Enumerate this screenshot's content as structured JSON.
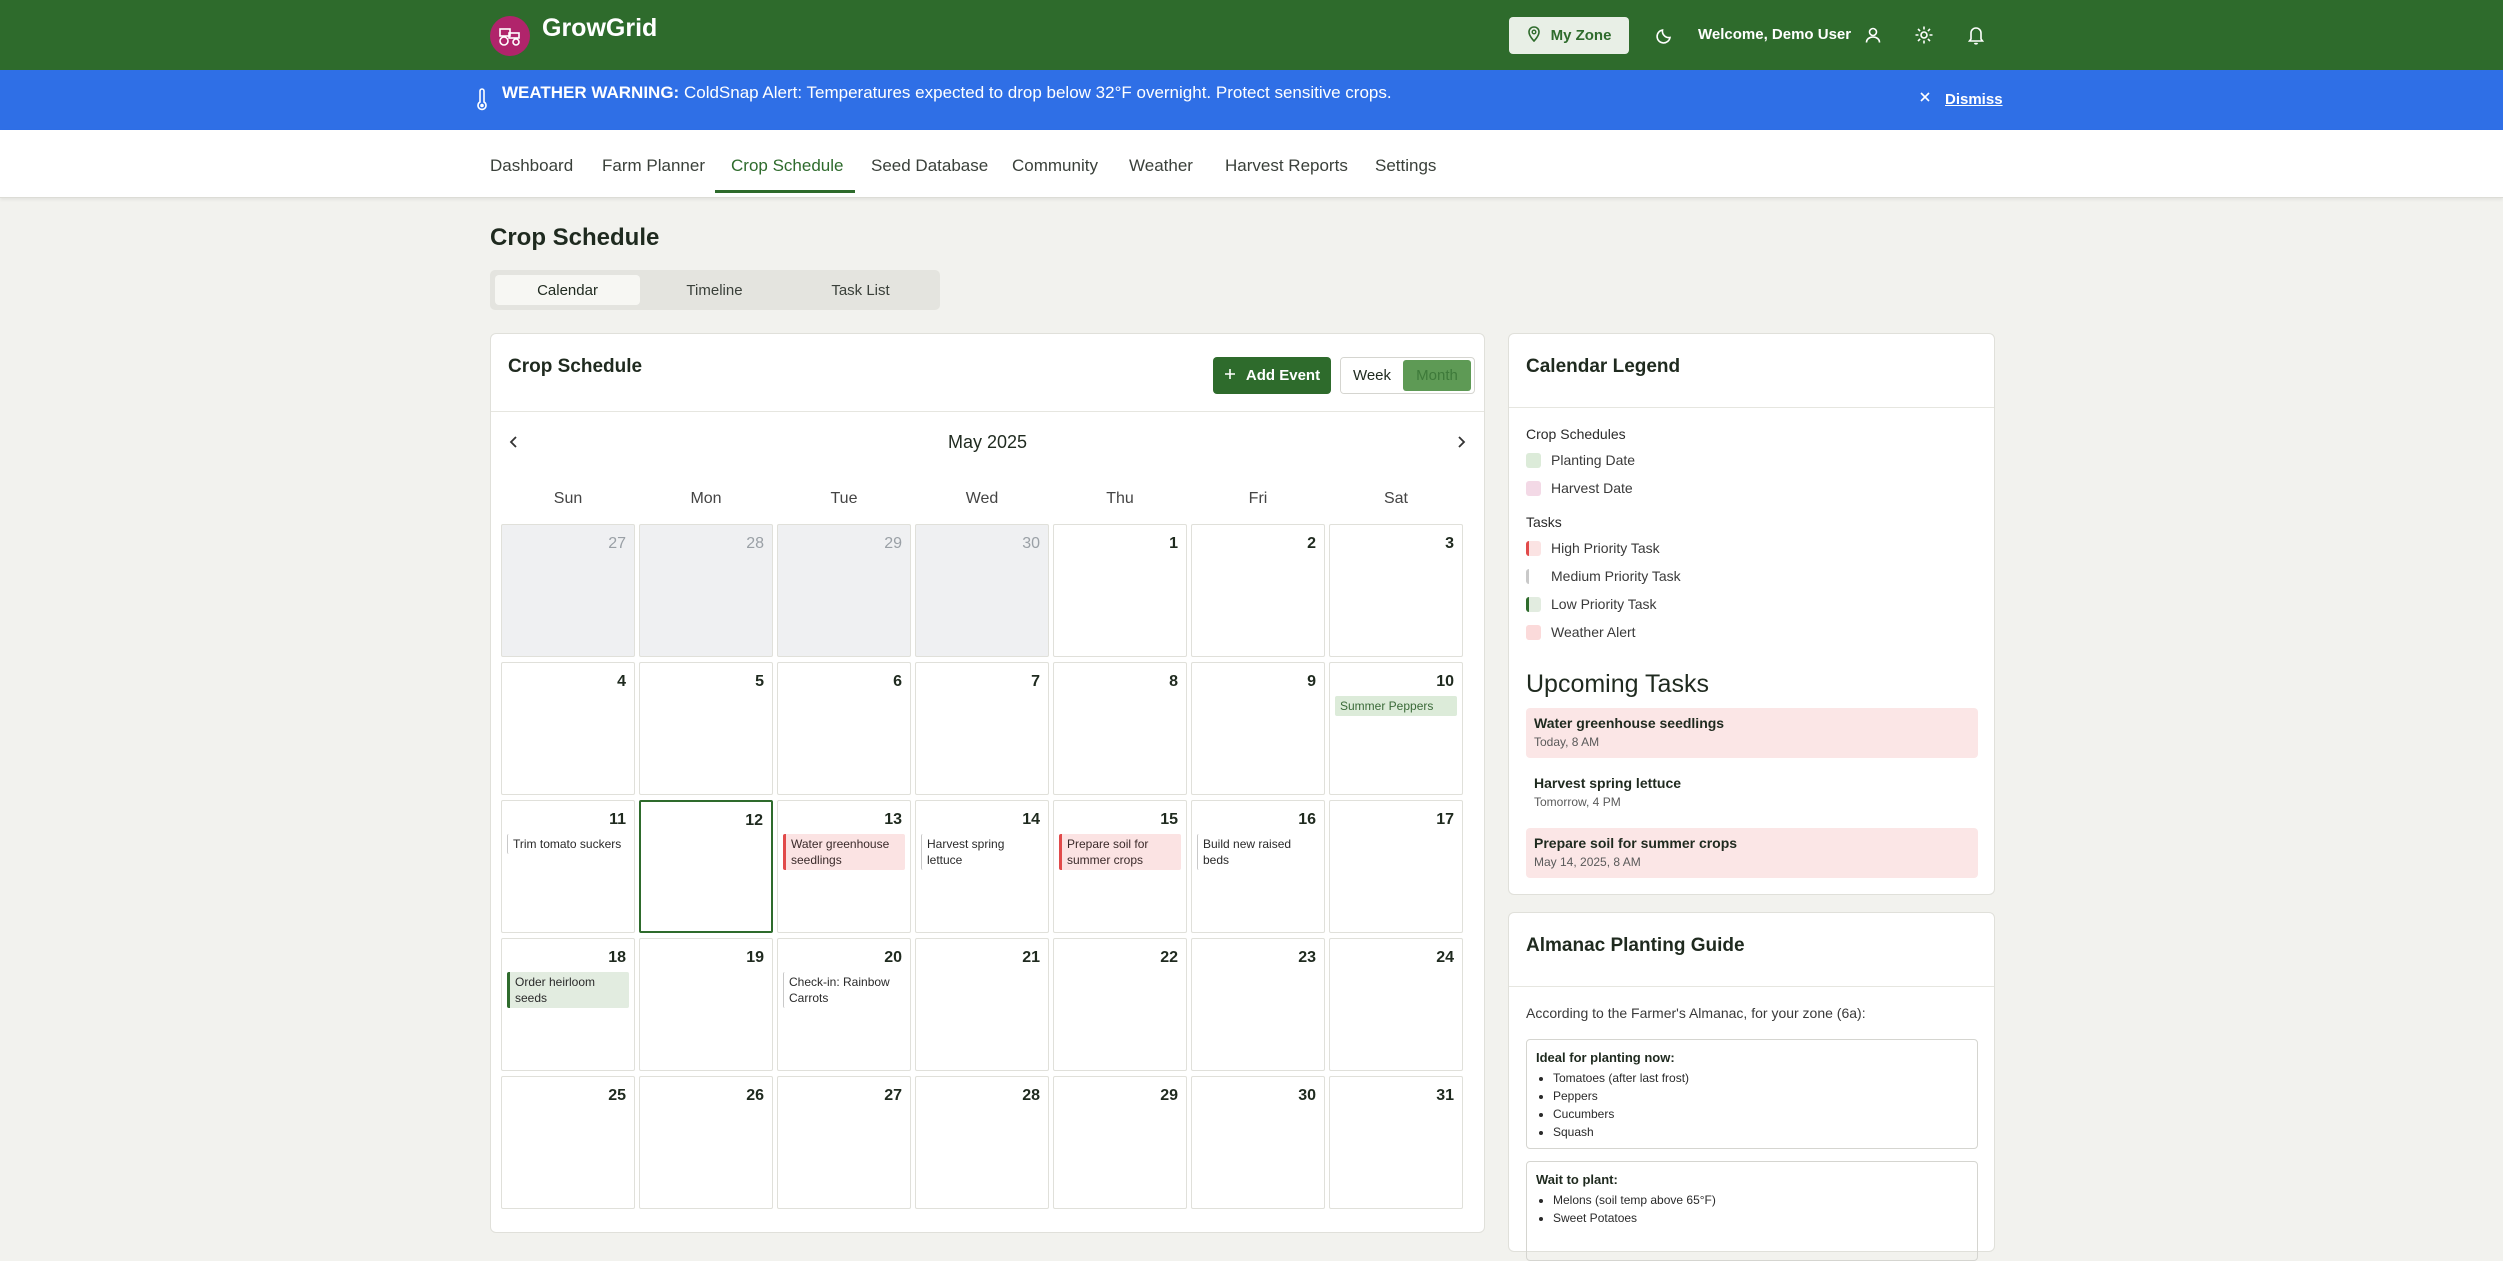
{
  "header": {
    "brand": "GrowGrid",
    "zone_label": "My Zone",
    "welcome": "Welcome, Demo User"
  },
  "banner": {
    "label": "WEATHER WARNING:",
    "message": " ColdSnap Alert: Temperatures expected to drop below 32°F overnight. Protect sensitive crops.",
    "dismiss": "Dismiss"
  },
  "nav": [
    "Dashboard",
    "Farm Planner",
    "Crop Schedule",
    "Seed Database",
    "Community",
    "Weather",
    "Harvest Reports",
    "Settings"
  ],
  "page": {
    "title": "Crop Schedule",
    "view_tabs": [
      "Calendar",
      "Timeline",
      "Task List"
    ]
  },
  "calendar": {
    "title": "Crop Schedule",
    "add_event": "Add Event",
    "week": "Week",
    "month": "Month",
    "month_label": "May 2025",
    "weekdays": [
      "Sun",
      "Mon",
      "Tue",
      "Wed",
      "Thu",
      "Fri",
      "Sat"
    ],
    "days": [
      {
        "n": "27",
        "muted": true
      },
      {
        "n": "28",
        "muted": true
      },
      {
        "n": "29",
        "muted": true
      },
      {
        "n": "30",
        "muted": true
      },
      {
        "n": "1"
      },
      {
        "n": "2"
      },
      {
        "n": "3"
      },
      {
        "n": "4"
      },
      {
        "n": "5"
      },
      {
        "n": "6"
      },
      {
        "n": "7"
      },
      {
        "n": "8"
      },
      {
        "n": "9"
      },
      {
        "n": "10",
        "event": {
          "text": "Summer Peppers",
          "kind": "plant"
        }
      },
      {
        "n": "11",
        "event": {
          "text": "Trim tomato suckers",
          "kind": "med"
        }
      },
      {
        "n": "12",
        "today": true
      },
      {
        "n": "13",
        "event": {
          "text": "Water greenhouse seedlings",
          "kind": "high"
        }
      },
      {
        "n": "14",
        "event": {
          "text": "Harvest spring lettuce",
          "kind": "med"
        }
      },
      {
        "n": "15",
        "event": {
          "text": "Prepare soil for summer crops",
          "kind": "high"
        }
      },
      {
        "n": "16",
        "event": {
          "text": "Build new raised beds",
          "kind": "med"
        }
      },
      {
        "n": "17"
      },
      {
        "n": "18",
        "event": {
          "text": "Order heirloom seeds",
          "kind": "low"
        }
      },
      {
        "n": "19"
      },
      {
        "n": "20",
        "event": {
          "text": "Check-in: Rainbow Carrots",
          "kind": "med"
        }
      },
      {
        "n": "21"
      },
      {
        "n": "22"
      },
      {
        "n": "23"
      },
      {
        "n": "24"
      },
      {
        "n": "25"
      },
      {
        "n": "26"
      },
      {
        "n": "27"
      },
      {
        "n": "28"
      },
      {
        "n": "29"
      },
      {
        "n": "30"
      },
      {
        "n": "31"
      }
    ]
  },
  "legend": {
    "title": "Calendar Legend",
    "crop_section": "Crop Schedules",
    "crop_items": [
      {
        "label": "Planting Date",
        "color": "#dcebd9"
      },
      {
        "label": "Harvest Date",
        "color": "#f3d9e6"
      }
    ],
    "task_section": "Tasks",
    "task_items": [
      {
        "label": "High Priority Task",
        "color": "#fbe3e3",
        "border": "#e14a4a"
      },
      {
        "label": "Medium Priority Task",
        "color": "#ffffff",
        "border": "#c9c9c9"
      },
      {
        "label": "Low Priority Task",
        "color": "#e2ece0",
        "border": "#2e6b2c"
      },
      {
        "label": "Weather Alert",
        "color": "#fbdada",
        "border": "#fbdada"
      }
    ],
    "upcoming_title": "Upcoming Tasks",
    "upcoming": [
      {
        "name": "Water greenhouse seedlings",
        "time": "Today, 8 AM",
        "high": true
      },
      {
        "name": "Harvest spring lettuce",
        "time": "Tomorrow, 4 PM",
        "high": false
      },
      {
        "name": "Prepare soil for summer crops",
        "time": "May 14, 2025, 8 AM",
        "high": true
      }
    ]
  },
  "almanac": {
    "title": "Almanac Planting Guide",
    "intro": "According to the Farmer's Almanac, for your zone (6a):",
    "ideal_title": "Ideal for planting now:",
    "ideal": [
      "Tomatoes (after last frost)",
      "Peppers",
      "Cucumbers",
      "Squash"
    ],
    "wait_title": "Wait to plant:",
    "wait": [
      "Melons (soil temp above 65°F)",
      "Sweet Potatoes"
    ]
  },
  "colors": {
    "header": "#2e6b2c",
    "banner": "#2f6fe6",
    "logo": "#b0246b"
  }
}
